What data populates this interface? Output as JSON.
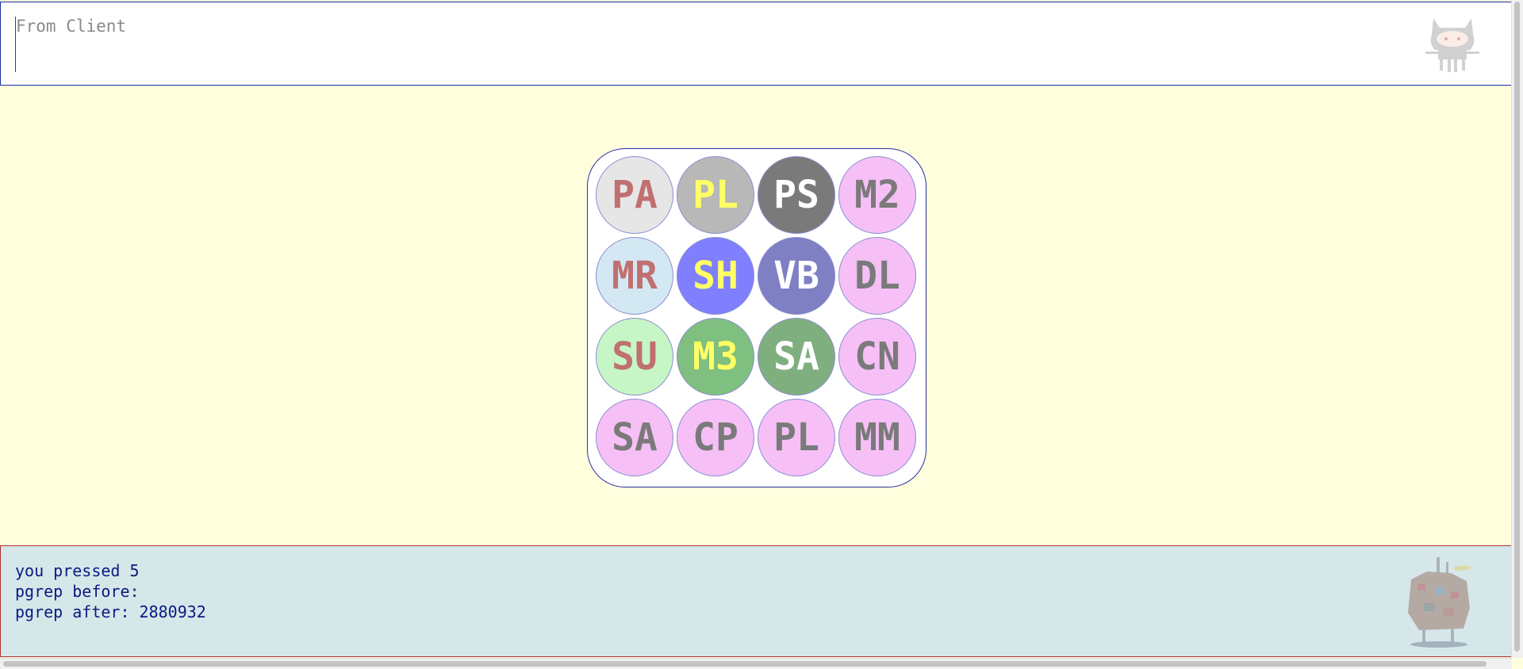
{
  "input": {
    "placeholder": "From Client",
    "value": ""
  },
  "grid": {
    "tiles": [
      {
        "label": "PA",
        "bg": "#e6e6e6",
        "fg": "#c07070"
      },
      {
        "label": "PL",
        "bg": "#b8b8b8",
        "fg": "#ffff66"
      },
      {
        "label": "PS",
        "bg": "#7a7a7a",
        "fg": "#ffffff"
      },
      {
        "label": "M2",
        "bg": "#f6c0f6",
        "fg": "#7a7a7a"
      },
      {
        "label": "MR",
        "bg": "#d4e8f4",
        "fg": "#c07070"
      },
      {
        "label": "SH",
        "bg": "#7f7fff",
        "fg": "#ffff66"
      },
      {
        "label": "VB",
        "bg": "#7f7fc4",
        "fg": "#ffffff"
      },
      {
        "label": "DL",
        "bg": "#f6c0f6",
        "fg": "#7a7a7a"
      },
      {
        "label": "SU",
        "bg": "#c6f6c6",
        "fg": "#c07070"
      },
      {
        "label": "M3",
        "bg": "#7fbf7f",
        "fg": "#ffff66"
      },
      {
        "label": "SA",
        "bg": "#7faf7f",
        "fg": "#ffffff"
      },
      {
        "label": "CN",
        "bg": "#f6c0f6",
        "fg": "#7a7a7a"
      },
      {
        "label": "SA",
        "bg": "#f6c0f6",
        "fg": "#7a7a7a"
      },
      {
        "label": "CP",
        "bg": "#f6c0f6",
        "fg": "#7a7a7a"
      },
      {
        "label": "PL",
        "bg": "#f6c0f6",
        "fg": "#7a7a7a"
      },
      {
        "label": "MM",
        "bg": "#f6c0f6",
        "fg": "#7a7a7a"
      }
    ]
  },
  "output": {
    "lines": [
      "you pressed 5",
      "pgrep before:",
      "pgrep after: 2880932"
    ]
  },
  "icons": {
    "top_right": "octocat-icon",
    "bottom_right": "castle-icon"
  }
}
